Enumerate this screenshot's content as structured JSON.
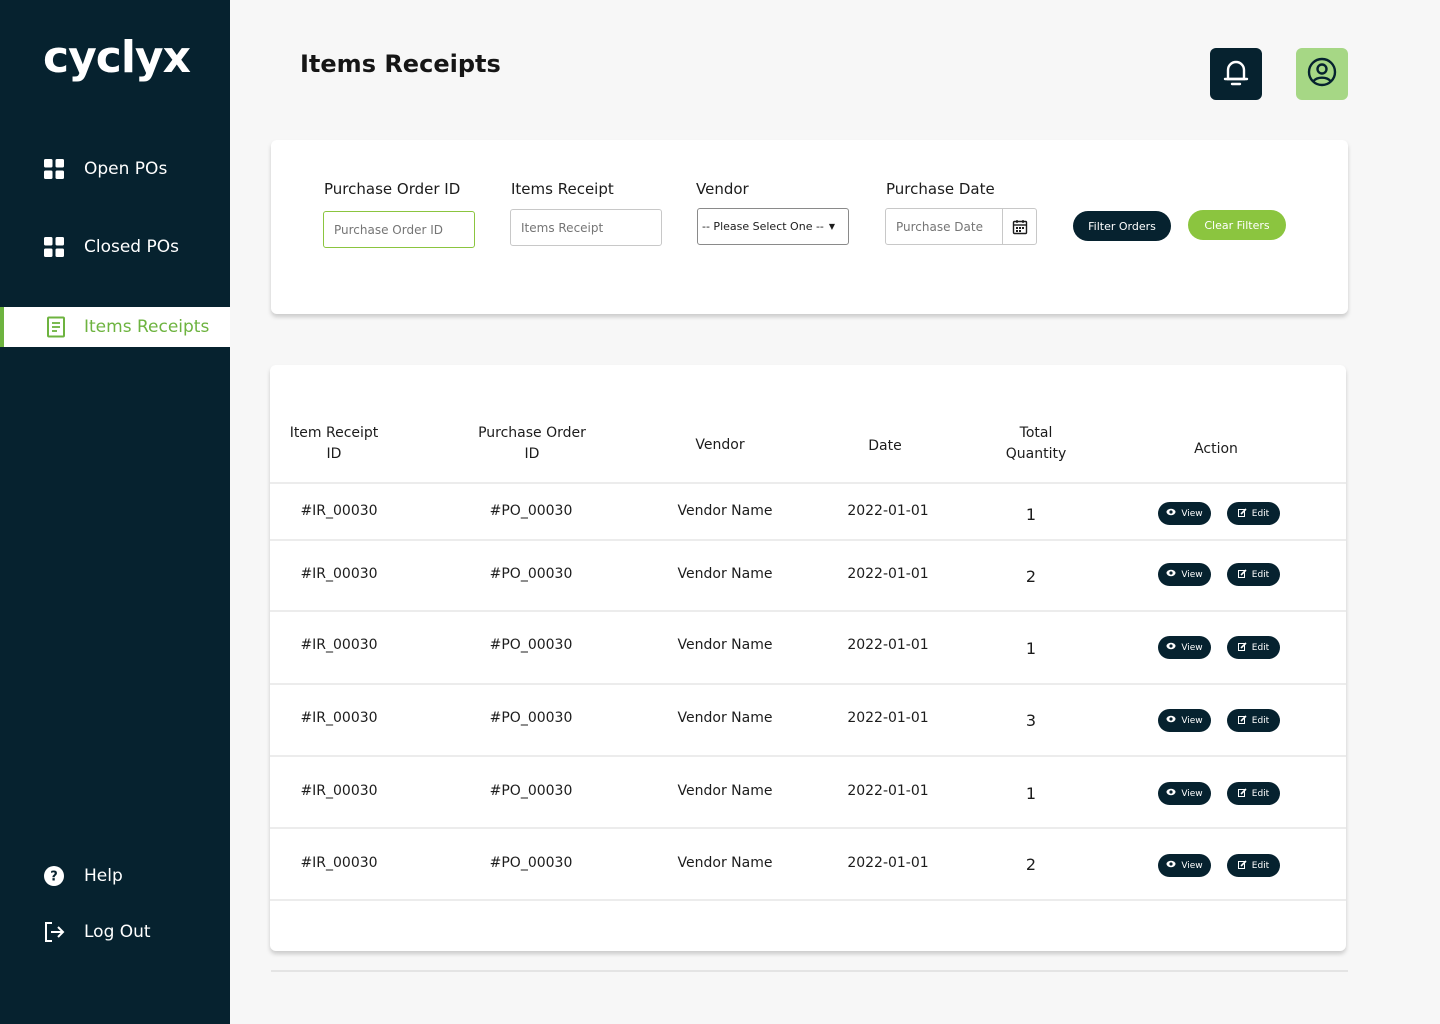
{
  "app": {
    "logo_text": "cycly",
    "logo_x": "x"
  },
  "sidebar": {
    "items": [
      {
        "label": "Open POs",
        "icon": "grid-icon"
      },
      {
        "label": "Closed POs",
        "icon": "grid-icon"
      },
      {
        "label": "Items Receipts",
        "icon": "document-icon",
        "active": true
      }
    ],
    "footer": [
      {
        "label": "Help",
        "icon": "help-icon"
      },
      {
        "label": "Log Out",
        "icon": "logout-icon"
      }
    ]
  },
  "header": {
    "title": "Items Receipts"
  },
  "filters": {
    "po_id": {
      "label": "Purchase Order ID",
      "placeholder": "Purchase Order ID"
    },
    "receipt": {
      "label": "Items Receipt",
      "placeholder": "Items Receipt"
    },
    "vendor": {
      "label": "Vendor",
      "value": "-- Please Select One --"
    },
    "date": {
      "label": "Purchase Date",
      "placeholder": "Purchase Date"
    },
    "filter_button": "Filter Orders",
    "clear_button": "Clear Filters"
  },
  "table": {
    "headers": {
      "receipt_id_1": "Item Receipt",
      "receipt_id_2": "ID",
      "po_id_1": "Purchase Order",
      "po_id_2": "ID",
      "vendor": "Vendor",
      "date": "Date",
      "qty_1": "Total",
      "qty_2": "Quantity",
      "action": "Action"
    },
    "rows": [
      {
        "receipt_id": "#IR_00030",
        "po_id": "#PO_00030",
        "vendor": "Vendor Name",
        "date": "2022-01-01",
        "qty": "1"
      },
      {
        "receipt_id": "#IR_00030",
        "po_id": "#PO_00030",
        "vendor": "Vendor Name",
        "date": "2022-01-01",
        "qty": "2"
      },
      {
        "receipt_id": "#IR_00030",
        "po_id": "#PO_00030",
        "vendor": "Vendor Name",
        "date": "2022-01-01",
        "qty": "1"
      },
      {
        "receipt_id": "#IR_00030",
        "po_id": "#PO_00030",
        "vendor": "Vendor Name",
        "date": "2022-01-01",
        "qty": "3"
      },
      {
        "receipt_id": "#IR_00030",
        "po_id": "#PO_00030",
        "vendor": "Vendor Name",
        "date": "2022-01-01",
        "qty": "1"
      },
      {
        "receipt_id": "#IR_00030",
        "po_id": "#PO_00030",
        "vendor": "Vendor Name",
        "date": "2022-01-01",
        "qty": "2"
      }
    ],
    "view_label": "View",
    "edit_label": "Edit"
  },
  "colors": {
    "navy": "#06222f",
    "green": "#8bc53f",
    "light_green": "#a6d785"
  }
}
